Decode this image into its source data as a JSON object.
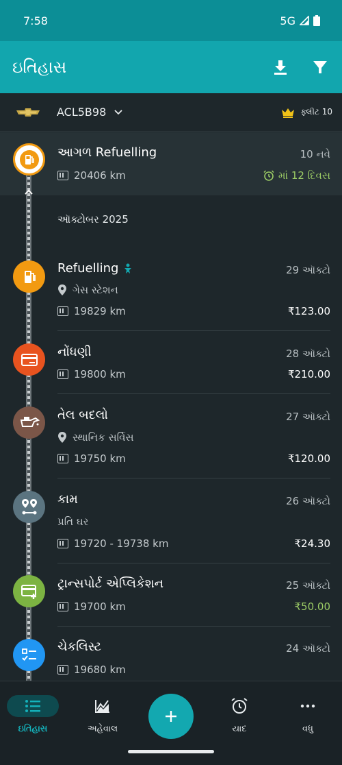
{
  "status": {
    "time": "7:58",
    "network": "5G"
  },
  "appbar": {
    "title": "ઇતિહાસ",
    "download_icon": "download-icon",
    "filter_icon": "filter-icon"
  },
  "vehicle": {
    "plate": "ACL5B98",
    "fleet_label": "ફ્લીટ 10",
    "brand_icon": "chevrolet-logo"
  },
  "upcoming": {
    "title": "આગળ Refuelling",
    "date": "10 નવે",
    "odometer": "20406 km",
    "due": "માં 12 દિવસ"
  },
  "month": "ઑક્ટોબર 2025",
  "entries": [
    {
      "title": "Refuelling",
      "date": "29 ઑક્ટો",
      "place": "ગેસ સ્ટેશન",
      "odometer": "19829 km",
      "amount": "₹123.00",
      "color": "#f29a11"
    },
    {
      "title": "નોંધણી",
      "date": "28 ઑક્ટો",
      "odometer": "19800 km",
      "amount": "₹210.00",
      "color": "#e8531f"
    },
    {
      "title": "તેલ બદલો",
      "date": "27 ઑક્ટો",
      "place": "સ્થાનિક સર્વિસ",
      "odometer": "19750 km",
      "amount": "₹120.00",
      "color": "#7b5648"
    },
    {
      "title": "કામ",
      "date": "26 ઑક્ટો",
      "note": "પ્રતિ ઘર",
      "odometer": "19720 - 19738 km",
      "amount": "₹24.30",
      "color": "#5b7480"
    },
    {
      "title": "ટ્રાન્સપોર્ટ એપ્લિકેશન",
      "date": "25 ઑક્ટો",
      "odometer": "19700 km",
      "amount": "₹50.00",
      "color": "#7cb342",
      "amount_color": "#9ccc65"
    },
    {
      "title": "ચેકલિસ્ટ",
      "date": "24 ઑક્ટો",
      "odometer": "19680 km",
      "color": "#2196f3"
    }
  ],
  "nav": {
    "history": "ઇતિહાસ",
    "reports": "અહેવાલ",
    "reminders": "યાદ",
    "more": "વધુ"
  },
  "colors": {
    "accent": "#12a6ae",
    "background": "#1e272b",
    "due_green": "#9ccc65"
  }
}
